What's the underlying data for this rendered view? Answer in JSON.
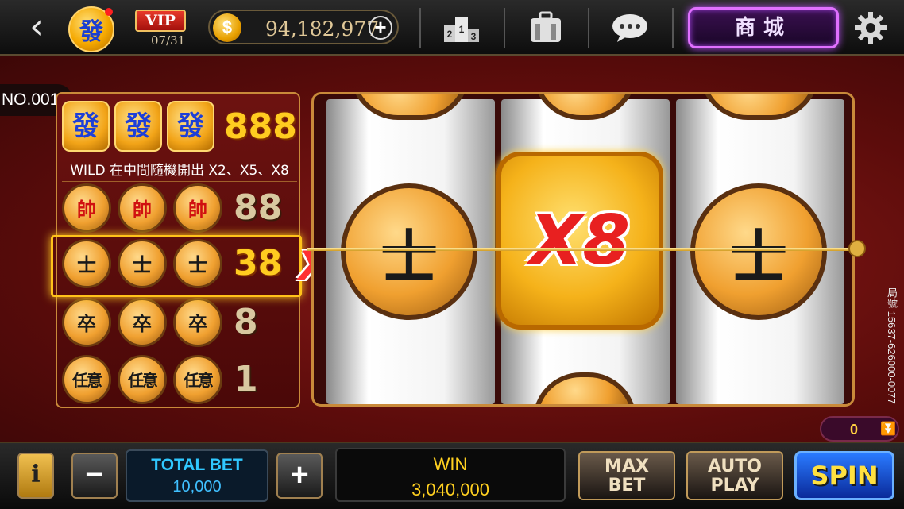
{
  "header": {
    "back_icon": "chevron-left-icon",
    "logo_glyph": "發",
    "vip": {
      "label": "VIP",
      "progress": "07/31"
    },
    "coins": {
      "icon": "dollar-coin-icon",
      "symbol": "$",
      "balance": "94,182,977",
      "add_label": "+"
    },
    "icons": [
      "leaderboard-icon",
      "backpack-icon",
      "chat-icon"
    ],
    "shop_label": "商城",
    "settings_icon": "gear-icon"
  },
  "paytable": {
    "no_label": "NO.001",
    "wild_note": "WILD 在中間隨機開出 X2、X5、X8",
    "rows": [
      {
        "symbols": [
          "發",
          "發",
          "發"
        ],
        "payout": "888"
      },
      {
        "symbols": [
          "帥",
          "帥",
          "帥"
        ],
        "payout": "88"
      },
      {
        "symbols": [
          "士",
          "士",
          "士"
        ],
        "payout": "38"
      },
      {
        "symbols": [
          "卒",
          "卒",
          "卒"
        ],
        "payout": "8"
      },
      {
        "symbols": [
          "任意",
          "任意",
          "任意"
        ],
        "payout": "1"
      }
    ],
    "highlight_multiplier": "X8"
  },
  "reels": {
    "left_symbol": "士",
    "center_symbol": "X8",
    "right_symbol": "士"
  },
  "session": {
    "id_label": "局號",
    "id": "15637-626000-0077"
  },
  "counter": {
    "value": "0"
  },
  "footer": {
    "info_label": "i",
    "minus_label": "−",
    "plus_label": "+",
    "total_bet_label": "TOTAL BET",
    "total_bet_value": "10,000",
    "win_label": "WIN",
    "win_value": "3,040,000",
    "max_bet_line1": "MAX",
    "max_bet_line2": "BET",
    "auto_play_line1": "AUTO",
    "auto_play_line2": "PLAY",
    "spin_label": "SPIN"
  }
}
